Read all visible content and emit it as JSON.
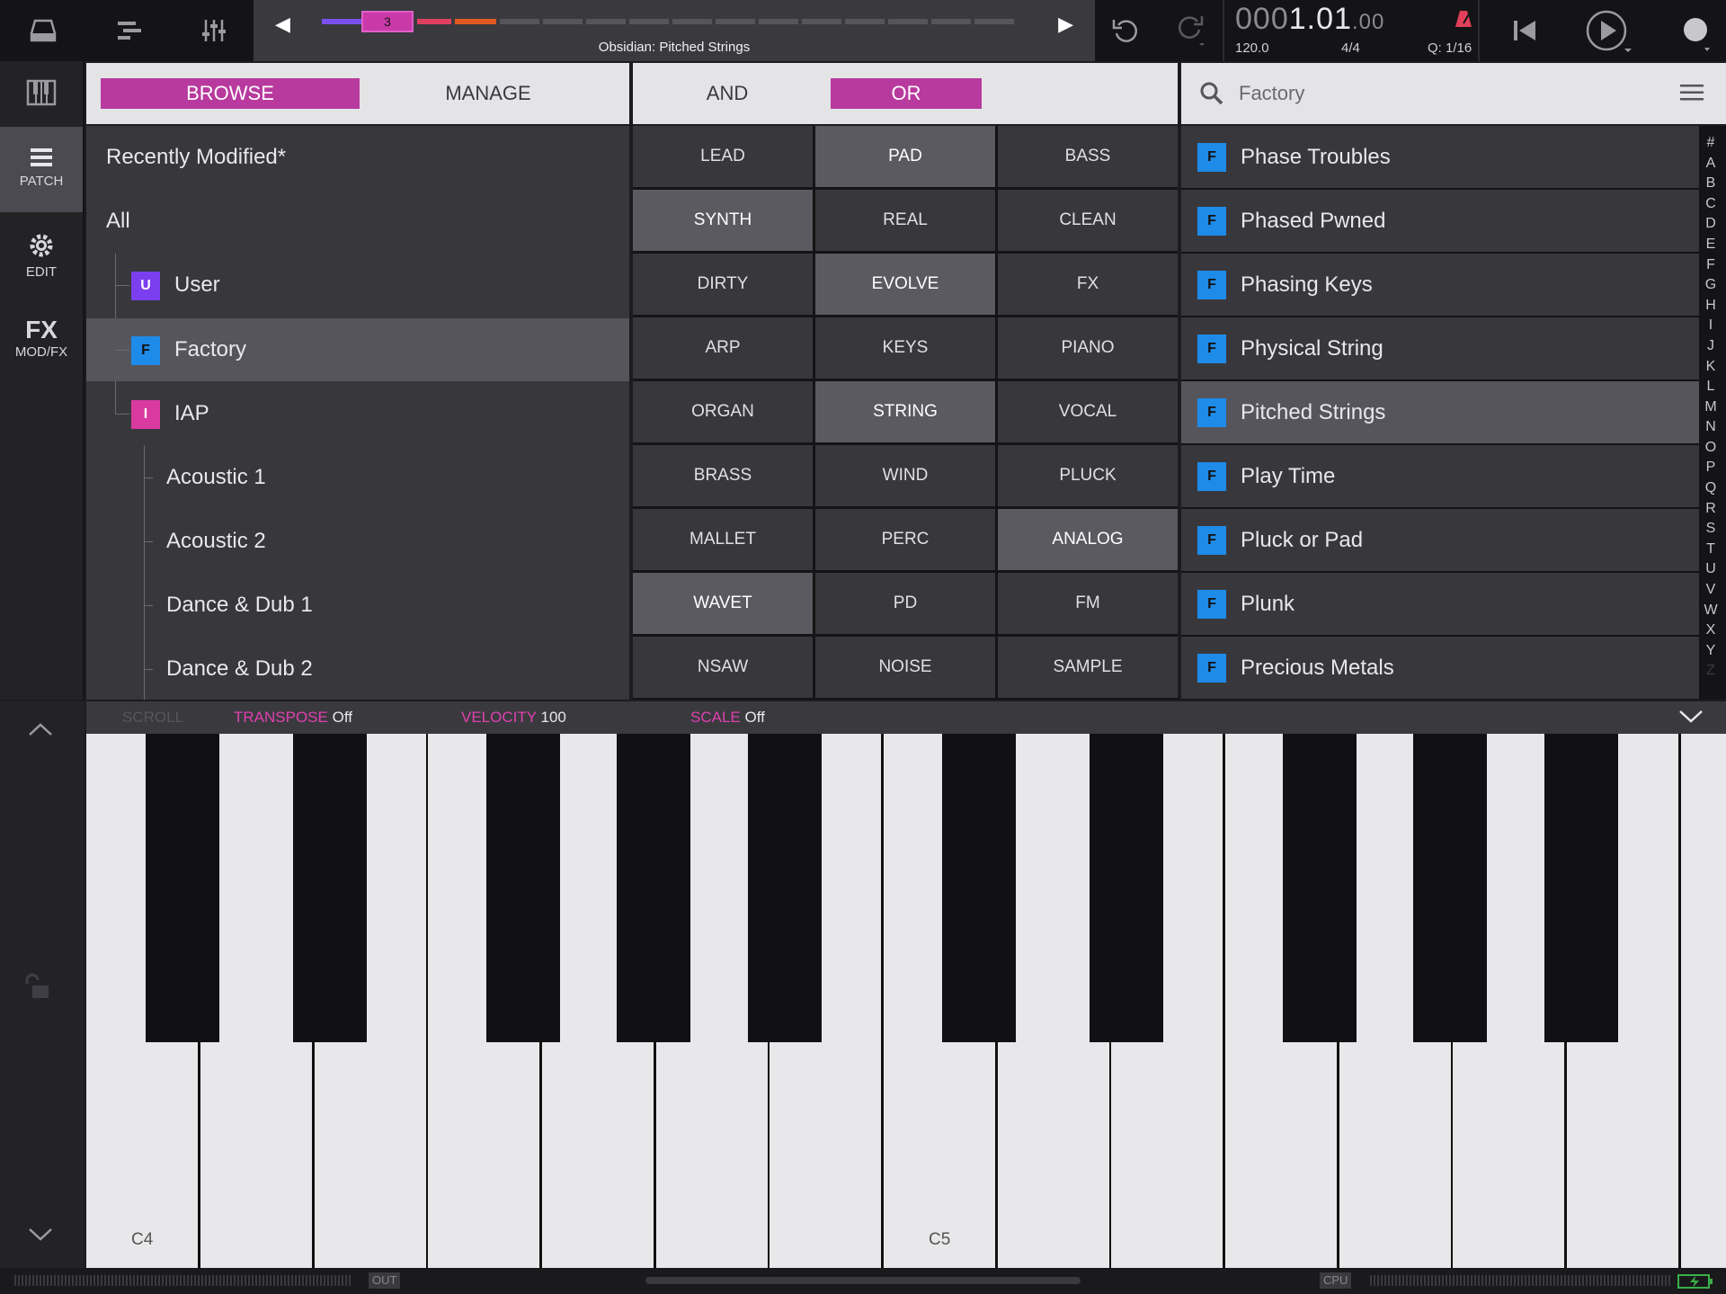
{
  "colors": {
    "accent": "#b83a9e",
    "factory_badge": "#1e8be8",
    "user_badge": "#7b3ff0",
    "iap_badge": "#d83aa0",
    "metronome": "#e0405a"
  },
  "sequencer": {
    "title": "Obsidian: Pitched Strings",
    "pattern_number": "3"
  },
  "transport": {
    "counter_dim": "000",
    "counter_main": "1.01",
    "counter_tail": ".00",
    "tempo": "120.0",
    "signature": "4/4",
    "quantize": "Q: 1/16"
  },
  "rail": {
    "patch_label": "PATCH",
    "edit_label": "EDIT",
    "fx_big": "FX",
    "fx_label": "MOD/FX"
  },
  "browse": {
    "browse_label": "BROWSE",
    "manage_label": "MANAGE"
  },
  "filter": {
    "and_label": "AND",
    "or_label": "OR"
  },
  "search": {
    "value": "Factory"
  },
  "tree": {
    "recent": "Recently Modified*",
    "all": "All",
    "user": {
      "badge": "U",
      "label": "User"
    },
    "factory": {
      "badge": "F",
      "label": "Factory"
    },
    "iap": {
      "badge": "I",
      "label": "IAP"
    },
    "children": [
      "Acoustic 1",
      "Acoustic 2",
      "Dance & Dub 1",
      "Dance & Dub 2"
    ]
  },
  "tags": [
    [
      "LEAD",
      "PAD",
      "BASS"
    ],
    [
      "SYNTH",
      "REAL",
      "CLEAN"
    ],
    [
      "DIRTY",
      "EVOLVE",
      "FX"
    ],
    [
      "ARP",
      "KEYS",
      "PIANO"
    ],
    [
      "ORGAN",
      "STRING",
      "VOCAL"
    ],
    [
      "BRASS",
      "WIND",
      "PLUCK"
    ],
    [
      "MALLET",
      "PERC",
      "ANALOG"
    ],
    [
      "WAVET",
      "PD",
      "FM"
    ],
    [
      "NSAW",
      "NOISE",
      "SAMPLE"
    ]
  ],
  "patches": {
    "badge": "F",
    "items": [
      "Phase Troubles",
      "Phased Pwned",
      "Phasing Keys",
      "Physical String",
      "Pitched Strings",
      "Play Time",
      "Pluck or Pad",
      "Plunk",
      "Precious Metals"
    ],
    "selected": "Pitched Strings"
  },
  "alphabet": [
    "#",
    "A",
    "B",
    "C",
    "D",
    "E",
    "F",
    "G",
    "H",
    "I",
    "J",
    "K",
    "L",
    "M",
    "N",
    "O",
    "P",
    "Q",
    "R",
    "S",
    "T",
    "U",
    "V",
    "W",
    "X",
    "Y",
    "Z"
  ],
  "keyboard_strip": {
    "scroll": "SCROLL",
    "transpose_key": "TRANSPOSE",
    "transpose_val": "Off",
    "velocity_key": "VELOCITY",
    "velocity_val": "100",
    "scale_key": "SCALE",
    "scale_val": "Off"
  },
  "keyboard": {
    "c4": "C4",
    "c5": "C5"
  },
  "status": {
    "out": "OUT",
    "cpu": "CPU"
  }
}
